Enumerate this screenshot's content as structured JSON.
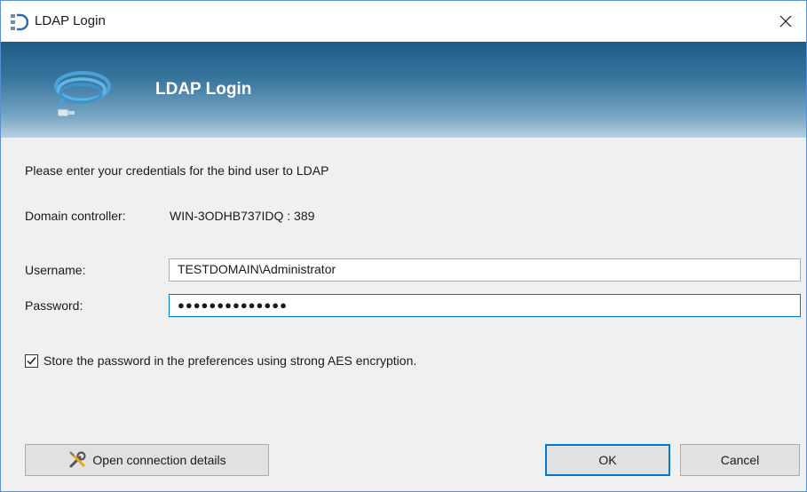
{
  "window": {
    "title": "LDAP Login",
    "close_glyph": "×",
    "icon": "ldap-app-icon",
    "accent_color": "#0078d7"
  },
  "banner": {
    "title": "LDAP Login",
    "icon": "network-cable-icon"
  },
  "form": {
    "intro": "Please enter your credentials for the bind user to LDAP",
    "domain_controller_label": "Domain controller:",
    "domain_controller_value": "WIN-3ODHB737IDQ : 389",
    "username_label": "Username:",
    "username_value": "TESTDOMAIN\\Administrator",
    "password_label": "Password:",
    "password_mask": "●●●●●●●●●●●●●●",
    "store_password_checked": true,
    "store_password_label": "Store the password in the preferences using strong AES encryption."
  },
  "buttons": {
    "open_connection_details": "Open connection details",
    "ok": "OK",
    "cancel": "Cancel"
  }
}
